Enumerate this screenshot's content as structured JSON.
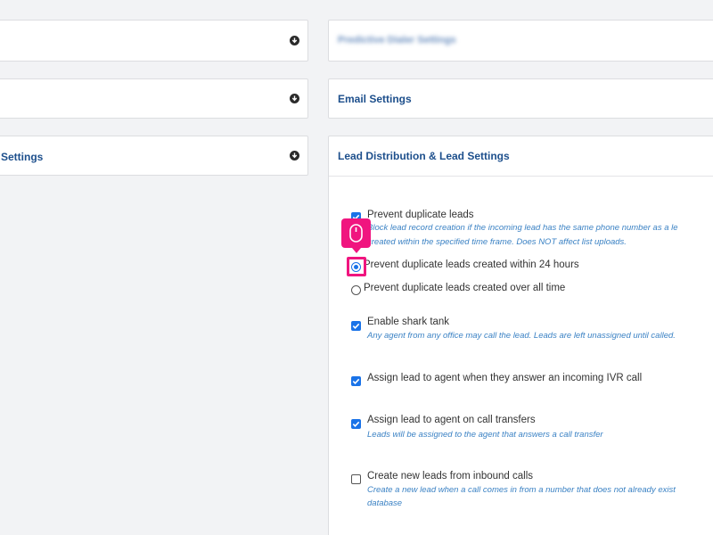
{
  "left_panels": [
    {
      "title": ""
    },
    {
      "title": ""
    },
    {
      "title": "Settings"
    }
  ],
  "right_panels": {
    "predictive_dialer": {
      "title": "Predictive Dialer Settings"
    },
    "email": {
      "title": "Email Settings"
    },
    "lead_distribution": {
      "title": "Lead Distribution & Lead Settings"
    }
  },
  "options": {
    "prevent_duplicate": {
      "label": "Prevent duplicate leads",
      "desc_line1": "Block lead record creation if the incoming lead has the same phone number as a le",
      "desc_line2": "created within the specified time frame. Does NOT affect list uploads.",
      "checked": true
    },
    "radio_24h": {
      "label": "Prevent duplicate leads created within 24 hours",
      "selected": true
    },
    "radio_all_time": {
      "label": "Prevent duplicate leads created over all time",
      "selected": false
    },
    "shark_tank": {
      "label": "Enable shark tank",
      "desc": "Any agent from any office may call the lead. Leads are left unassigned until called.",
      "checked": true
    },
    "ivr_assign": {
      "label": "Assign lead to agent when they answer an incoming IVR call",
      "checked": true
    },
    "transfer_assign": {
      "label": "Assign lead to agent on call transfers",
      "desc": "Leads will be assigned to the agent that answers a call transfer",
      "checked": true
    },
    "inbound_create": {
      "label": "Create new leads from inbound calls",
      "desc_line1": "Create a new lead when a call comes in from a number that does not already exist",
      "desc_line2": "database",
      "checked": false
    }
  },
  "colors": {
    "header_text": "#1d4f8c",
    "description_text": "#3b82c4",
    "checkbox_blue": "#1a73e8",
    "click_marker": "#f0157f",
    "background": "#f2f3f5"
  }
}
